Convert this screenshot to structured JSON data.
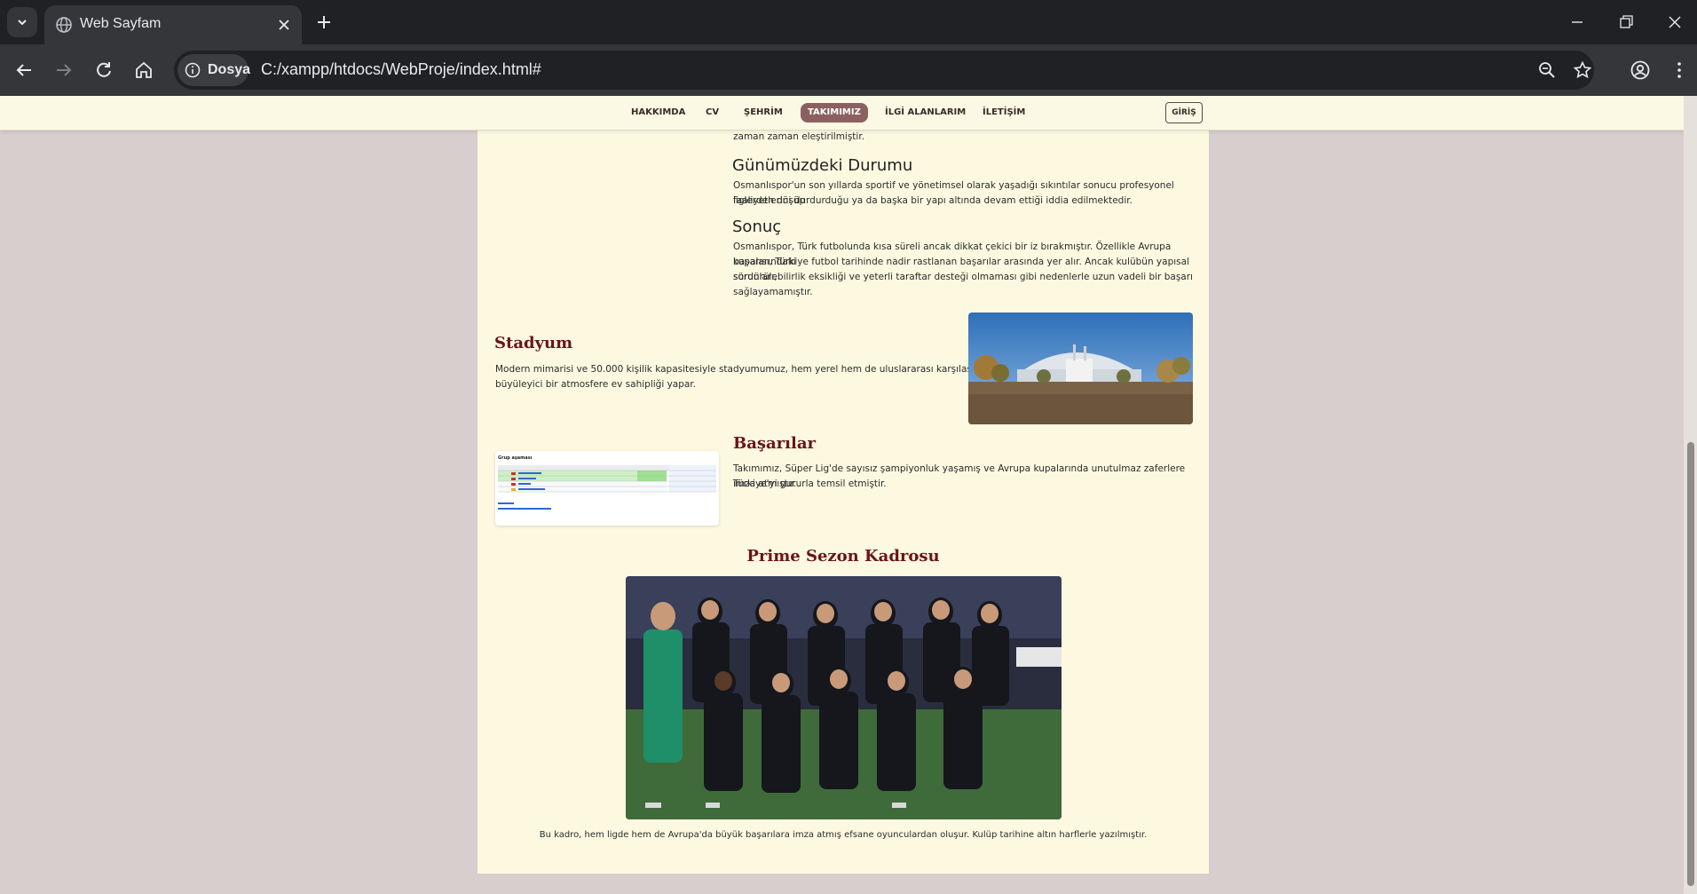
{
  "browser": {
    "tab_title": "Web Sayfam",
    "site_chip_label": "Dosya",
    "url": "C:/xampp/htdocs/WebProje/index.html#"
  },
  "nav": {
    "items": [
      "HAKKIMDA",
      "CV",
      "ŞEHRİM",
      "TAKIMIMIZ",
      "İLGİ ALANLARIM",
      "İLETİŞİM"
    ],
    "active": "TAKIMIMIZ",
    "login_label": "GİRİŞ"
  },
  "history": {
    "tail_text": "zaman zaman eleştirilmiştir.",
    "current_heading": "Günümüzdeki Durumu",
    "current_lines": [
      "Osmanlıspor'un son yıllarda sportif ve yönetimsel olarak yaşadığı sıkıntılar sonucu profesyonel liglerden düşüp",
      "faaliyetlerini durdurduğu ya da başka bir yapı altında devam ettiği iddia edilmektedir."
    ],
    "result_heading": "Sonuç",
    "result_lines": [
      "Osmanlıspor, Türk futbolunda kısa süreli ancak dikkat çekici bir iz bırakmıştır. Özellikle Avrupa kupalarındaki",
      "başarısı, Türkiye futbol tarihinde nadir rastlanan başarılar arasında yer alır. Ancak kulübün yapısal sorunları,",
      "sürdürülebilirlik eksikliği ve yeterli taraftar desteği olmaması gibi nedenlerle uzun vadeli bir başarı",
      "sağlayamamıştır."
    ]
  },
  "stadium": {
    "heading": "Stadyum",
    "lines": [
      "Modern mimarisi ve 50.000 kişilik kapasitesiyle stadyumumuz, hem yerel hem de uluslararası karşılaşmalarda",
      "büyüleyici bir atmosfere ev sahipliği yapar."
    ]
  },
  "achievements": {
    "heading": "Başarılar",
    "lines": [
      "Takımımız, Süper Lig'de sayısız şampiyonluk yaşamış ve Avrupa kupalarında unutulmaz zaferlere imza atmıştır.",
      "Türkiye'yi gururla temsil etmiştir."
    ],
    "table_title": "Grup aşaması"
  },
  "squad": {
    "heading": "Prime Sezon Kadrosu",
    "caption": "Bu kadro, hem ligde hem de Avrupa'da büyük başarılara imza atmış efsane oyunculardan oluşur. Kulüp tarihine altın harflerle yazılmıştır."
  }
}
